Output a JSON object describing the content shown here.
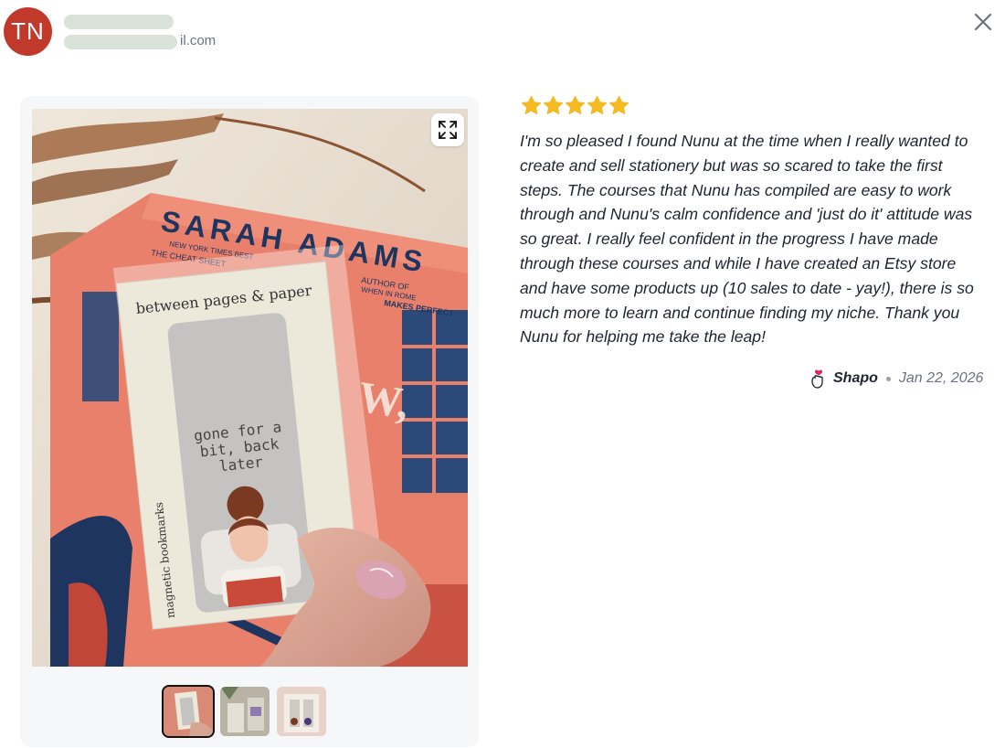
{
  "user": {
    "initials": "TN",
    "name": "",
    "email": "il.com",
    "avatar_color": "#c0392b"
  },
  "review": {
    "rating": 5,
    "max_rating": 5,
    "star_color": "#f5b921",
    "text": "I'm so pleased I found Nunu at the time when I really wanted to create and sell stationery but was so scared to take the first steps. The courses that Nunu has compiled are easy to work through and Nunu's calm confidence and 'just do it' attitude was so great. I really feel confident in the progress I have made through these courses and while I have created an Etsy store and have some products up (10 sales to date - yay!), there is so much more to learn and continue finding my niche. Thank you Nunu for helping me take the leap!",
    "source": "Shapo",
    "date": "Jan 22, 2026"
  },
  "media": {
    "selected_index": 0,
    "thumbnail_count": 3,
    "photo": {
      "book_author": "SARAH ADAMS",
      "book_tag_top": "NEW YORK TIMES BEST",
      "book_tag_sub": "THE CHEAT SHEET",
      "book_author_of": "AUTHOR OF",
      "book_author_of_sub": "WHEN IN ROME",
      "book_makes": "MAKES PERFECT",
      "card_brand": "between pages & paper",
      "bookmark_text": "gone for a bit, back later",
      "card_side_text": "magnetic bookmarks"
    }
  },
  "icons": {
    "close": "close-icon",
    "expand": "expand-icon",
    "star": "star-icon",
    "source": "shapo-icon"
  }
}
